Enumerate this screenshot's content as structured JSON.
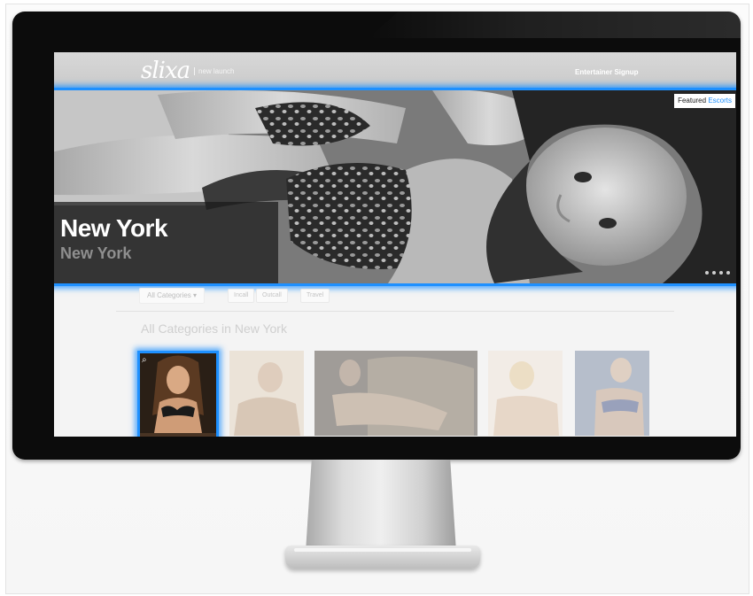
{
  "site": {
    "logo": "slixa",
    "tagline": "new launch",
    "signup_label": "Entertainer Signup"
  },
  "hero": {
    "title": "New York",
    "subtitle": "New York",
    "badge_prefix": "Featured",
    "badge_accent": "Escorts",
    "slides": 4
  },
  "filters": {
    "category_label": "All Categories ▾",
    "buttons": [
      "Incall",
      "Outcall",
      "Travel"
    ]
  },
  "section": {
    "title": "All Categories in New York"
  },
  "colors": {
    "highlight": "#1e90ff",
    "bezel": "#0c0c0c",
    "header": "#cfcfcf"
  }
}
